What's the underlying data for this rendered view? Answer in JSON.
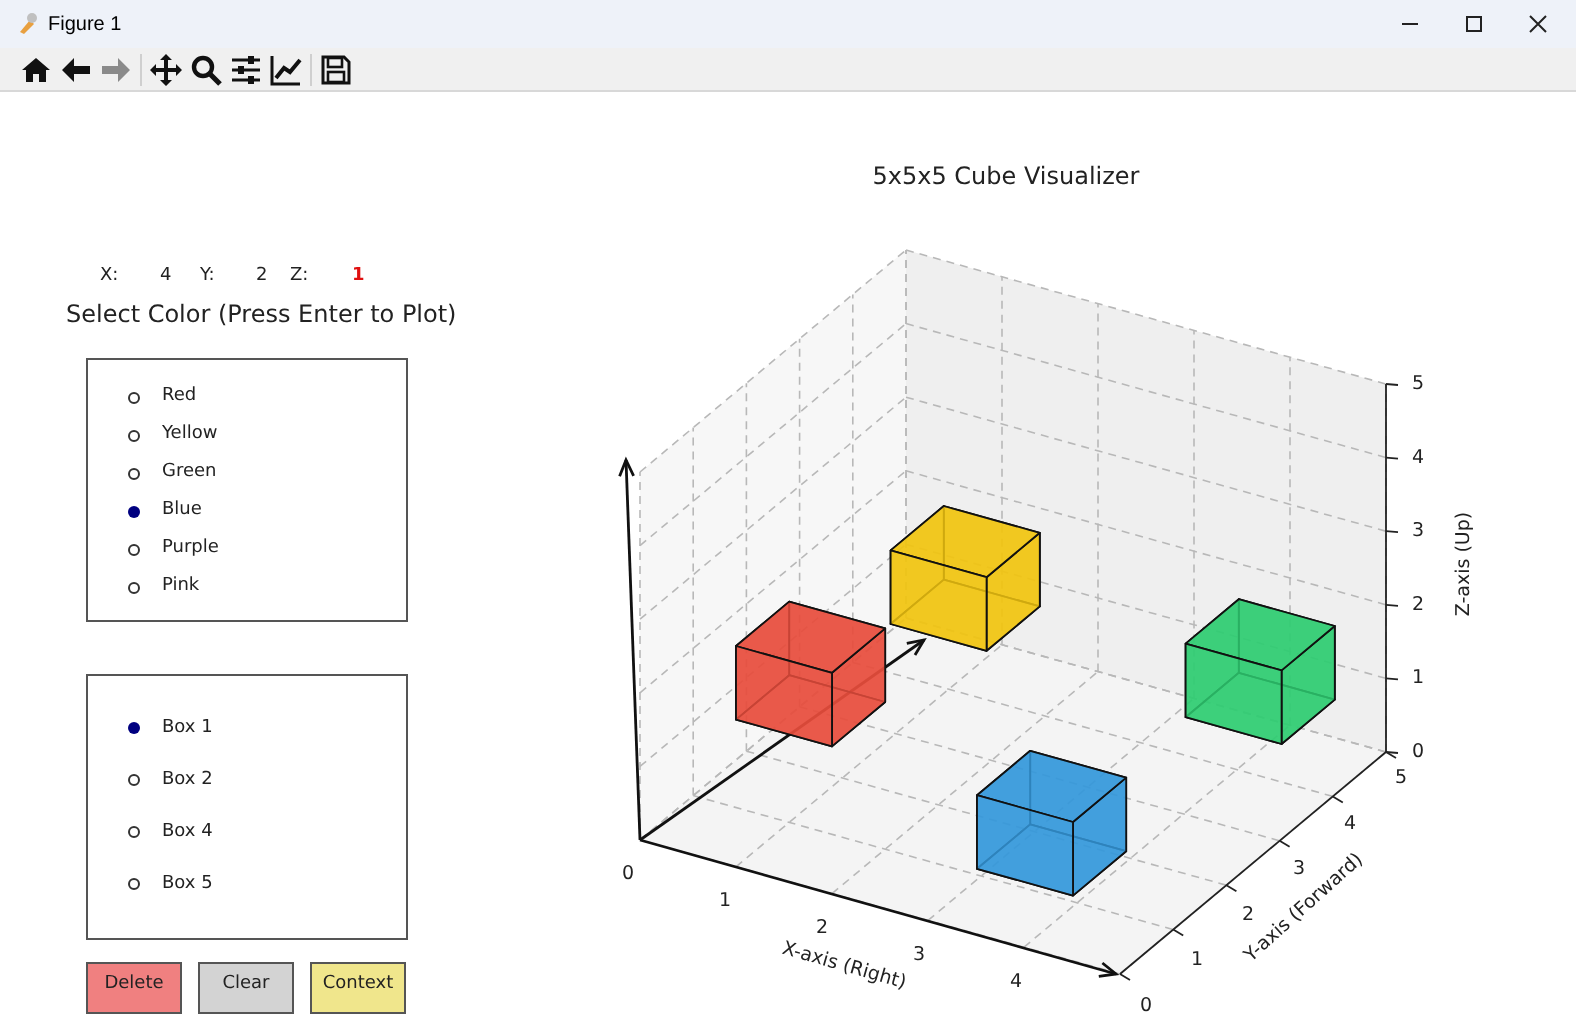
{
  "window": {
    "title": "Figure 1"
  },
  "toolbar": [
    {
      "kind": "home",
      "disabled": false
    },
    {
      "kind": "back",
      "disabled": false
    },
    {
      "kind": "forward",
      "disabled": true
    },
    {
      "kind": "pan",
      "disabled": false
    },
    {
      "kind": "zoom",
      "disabled": false
    },
    {
      "kind": "configure",
      "disabled": false
    },
    {
      "kind": "edit",
      "disabled": false
    },
    {
      "kind": "save",
      "disabled": false
    }
  ],
  "coordinates": [
    {
      "label": "X:",
      "value": "4",
      "highlighted": false
    },
    {
      "label": "Y:",
      "value": "2",
      "highlighted": false
    },
    {
      "label": "Z:",
      "value": "1",
      "highlighted": true
    }
  ],
  "color_selector": {
    "title": "Select Color (Press Enter to Plot)",
    "options": [
      {
        "label": "Red",
        "selected": false
      },
      {
        "label": "Yellow",
        "selected": false
      },
      {
        "label": "Green",
        "selected": false
      },
      {
        "label": "Blue",
        "selected": true
      },
      {
        "label": "Purple",
        "selected": false
      },
      {
        "label": "Pink",
        "selected": false
      }
    ]
  },
  "box_list": {
    "items": [
      {
        "label": "Box 1",
        "selected": true
      },
      {
        "label": "Box 2",
        "selected": false
      },
      {
        "label": "Box 4",
        "selected": false
      },
      {
        "label": "Box 5",
        "selected": false
      }
    ]
  },
  "buttons": [
    {
      "label": "Delete",
      "color": "#f08080"
    },
    {
      "label": "Clear",
      "color": "#d3d3d3"
    },
    {
      "label": "Context",
      "color": "#f0e68c"
    }
  ],
  "plot": {
    "title": "5x5x5 Cube Visualizer",
    "x_axis": {
      "label": "X-axis (Right)",
      "ticks": [
        "0",
        "1",
        "2",
        "3",
        "4"
      ]
    },
    "y_axis": {
      "label": "Y-axis (Forward)",
      "ticks": [
        "0",
        "1",
        "2",
        "3",
        "4",
        "5"
      ]
    },
    "z_axis": {
      "label": "Z-axis (Up)",
      "ticks": [
        "5",
        "4",
        "3",
        "2",
        "1",
        "0"
      ]
    }
  }
}
